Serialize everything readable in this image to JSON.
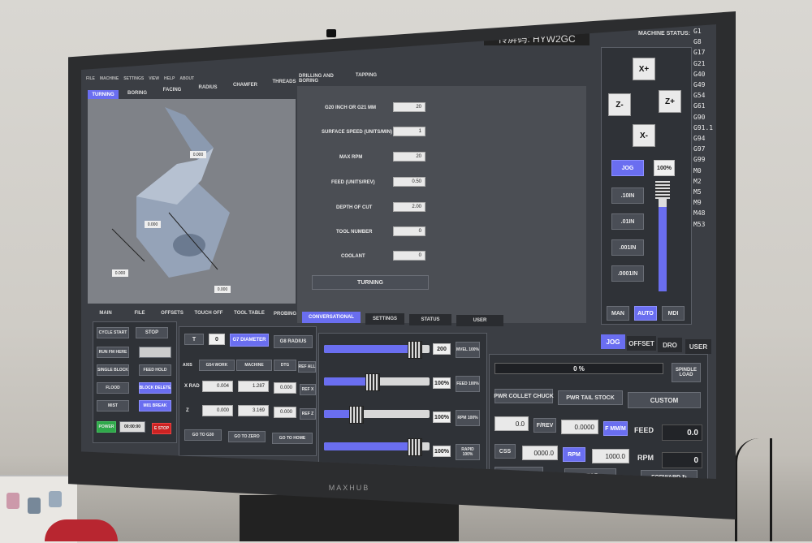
{
  "overlay_code": "传屏码: HYW2GC",
  "bezel_brand": "MAXHUB",
  "menu": [
    "FILE",
    "MACHINE",
    "SETTINGS",
    "VIEW",
    "HELP",
    "ABOUT"
  ],
  "conv_tabs": [
    "TURNING",
    "BORING",
    "FACING",
    "RADIUS",
    "CHAMFER",
    "THREADS",
    "DRILLING AND BORING",
    "TAPPING"
  ],
  "active_conv_tab": "TURNING",
  "drawing_dims": [
    "0.000",
    "0.000",
    "0.000",
    "0.000"
  ],
  "params": [
    {
      "label": "G20 INCH OR G21 MM",
      "value": "20"
    },
    {
      "label": "SURFACE SPEED (UNITS/MIN)",
      "value": "1"
    },
    {
      "label": "MAX RPM",
      "value": "20"
    },
    {
      "label": "FEED (UNITS/REV)",
      "value": "0.50"
    },
    {
      "label": "DEPTH OF CUT",
      "value": "2.00"
    },
    {
      "label": "TOOL NUMBER",
      "value": "0"
    },
    {
      "label": "COOLANT",
      "value": "0"
    }
  ],
  "turning_button": "TURNING",
  "machine_status": {
    "title": "MACHINE STATUS:",
    "codes": [
      "G1",
      "G8",
      "G17",
      "G21",
      "G40",
      "G49",
      "G54",
      "G61",
      "G90",
      "G91.1",
      "G94",
      "G97",
      "G99",
      "M0",
      "M2",
      "M5",
      "M9",
      "M48",
      "M53"
    ]
  },
  "jog_buttons": {
    "xplus": "X+",
    "xminus": "X-",
    "zplus": "Z+",
    "zminus": "Z-"
  },
  "jog": {
    "jog_label": "JOG",
    "percent": "100%",
    "increments": [
      ".10IN",
      ".01IN",
      ".001IN",
      ".0001IN"
    ],
    "slider_level": 0.8
  },
  "modes": [
    "MAN",
    "AUTO",
    "MDI"
  ],
  "active_mode": "AUTO",
  "main_tabs": [
    "MAIN",
    "FILE",
    "OFFSETS",
    "TOUCH OFF",
    "TOOL TABLE",
    "PROBING",
    "CONVERSATIONAL",
    "SETTINGS",
    "STATUS",
    "USER"
  ],
  "active_main_tab": "CONVERSATIONAL",
  "right_tabs": [
    "JOG",
    "OFFSET",
    "DRO",
    "USER"
  ],
  "active_right_tab": "JOG",
  "left_buttons": {
    "cycle_start": "CYCLE START",
    "stop": "STOP",
    "run_from_here": "RUN FM HERE",
    "single_block": "SINGLE BLOCK",
    "feed_hold": "FEED HOLD",
    "flood": "FLOOD",
    "block_delete": "BLOCK DELETE",
    "mist": "MIST",
    "m01_break": "M01 BREAK",
    "power": "POWER",
    "time": "00:00:00",
    "estop": "E STOP"
  },
  "dro": {
    "tool_label": "T",
    "tool_value": "0",
    "diameter": "G7 DIAMETER",
    "radius": "G8 RADIUS",
    "work": "G54 WORK",
    "machine": "MACHINE",
    "dtg": "DTG",
    "ref_all": "REF ALL",
    "rows": [
      {
        "axis": "X RAD",
        "work": "0.004",
        "machine": "1.287",
        "dtg": "0.000",
        "ref": "REF X"
      },
      {
        "axis": "Z",
        "work": "0.000",
        "machine": "3.169",
        "dtg": "0.000",
        "ref": "REF Z"
      }
    ],
    "go_g30": "GO TO G30",
    "go_zero": "GO TO ZERO",
    "go_home": "GO TO HOME"
  },
  "overrides": [
    {
      "value": "200",
      "label": "MVEL 100%",
      "level": 0.85
    },
    {
      "value": "100%",
      "label": "FEED 100%",
      "level": 0.45
    },
    {
      "value": "100%",
      "label": "RPM 100%",
      "level": 0.3
    },
    {
      "value": "100%",
      "label": "RAPID 100%",
      "level": 0.85
    }
  ],
  "spindle": {
    "load_pct": "0 %",
    "load_label": "SPINDLE LOAD",
    "progress": 0,
    "collet": "PWR COLLET CHUCK",
    "tailstock": "PWR TAIL STOCK",
    "custom": "CUSTOM",
    "feed_value": "0.0",
    "frev": "F/REV",
    "feed_set": "0.0000",
    "fmm": "F MM/M",
    "feed_label": "FEED",
    "feed_readout": "0.0",
    "css": "CSS",
    "css_value": "0000.0",
    "rpm_btn": "RPM",
    "rpm_set": "1000.0",
    "rpm_label": "RPM",
    "rpm_readout": "0",
    "reverse": "↻ REVERSE",
    "stop": "STOP",
    "forward": "FORWARD ↻"
  }
}
